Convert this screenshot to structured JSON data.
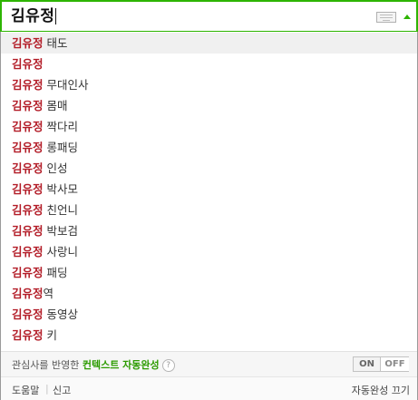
{
  "search": {
    "query": "김유정"
  },
  "suggestions": [
    {
      "keyword": "김유정",
      "rest": " 태도",
      "selected": true
    },
    {
      "keyword": "김유정",
      "rest": ""
    },
    {
      "keyword": "김유정",
      "rest": " 무대인사"
    },
    {
      "keyword": "김유정",
      "rest": " 몸매"
    },
    {
      "keyword": "김유정",
      "rest": " 짝다리"
    },
    {
      "keyword": "김유정",
      "rest": " 롱패딩"
    },
    {
      "keyword": "김유정",
      "rest": " 인성"
    },
    {
      "keyword": "김유정",
      "rest": " 박사모"
    },
    {
      "keyword": "김유정",
      "rest": " 친언니"
    },
    {
      "keyword": "김유정",
      "rest": " 박보검"
    },
    {
      "keyword": "김유정",
      "rest": " 사랑니"
    },
    {
      "keyword": "김유정",
      "rest": " 패딩"
    },
    {
      "keyword": "김유정",
      "rest": "역"
    },
    {
      "keyword": "김유정",
      "rest": " 동영상"
    },
    {
      "keyword": "김유정",
      "rest": " 키"
    }
  ],
  "context_bar": {
    "prefix": "관심사를 반영한 ",
    "highlight": "컨텍스트 자동완성",
    "help_mark": "?",
    "toggle_on": "ON",
    "toggle_off": "OFF"
  },
  "footer": {
    "help": "도움말",
    "separator": "|",
    "report": "신고",
    "autocomplete_off": "자동완성 끄기"
  },
  "colors": {
    "accent": "#2db400",
    "keyword": "#b31d28",
    "context_highlight": "#2c9b00"
  }
}
